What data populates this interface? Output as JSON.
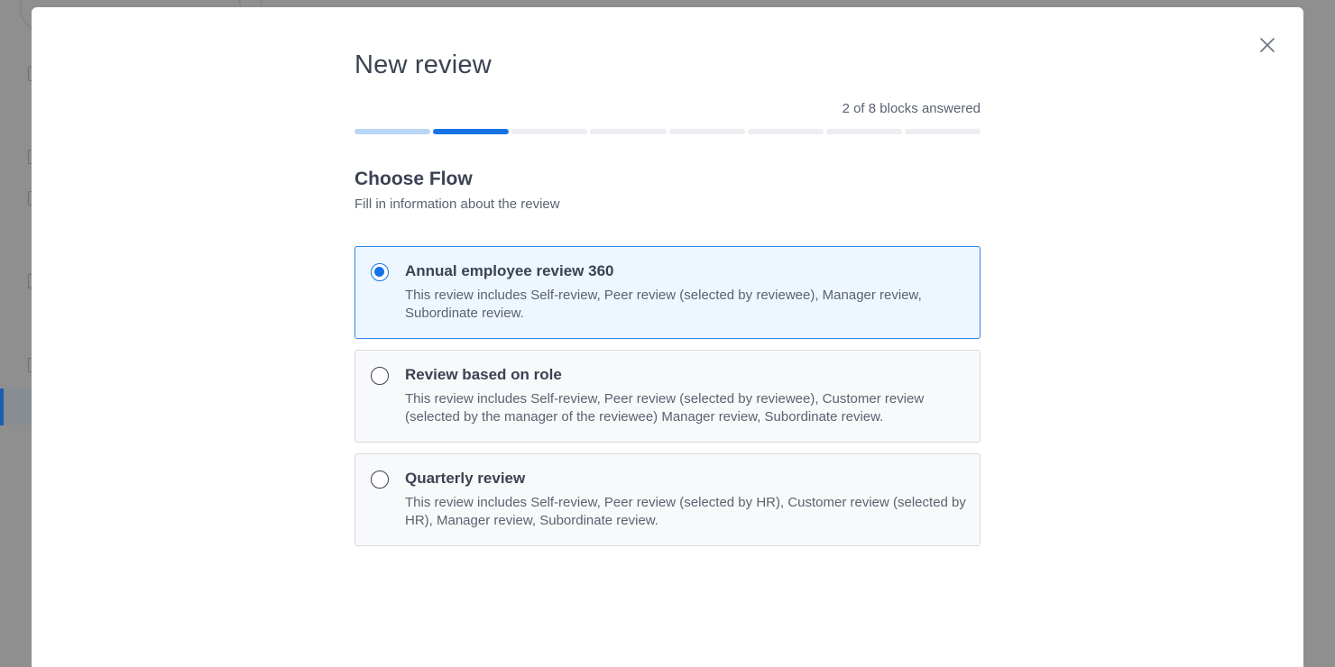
{
  "modal": {
    "title": "New review",
    "progress_text": "2 of 8 blocks answered",
    "progress": {
      "answered": 2,
      "total": 8,
      "current": 2
    },
    "section_title": "Choose Flow",
    "section_subtitle": "Fill in information about the review",
    "selected_index": 0,
    "options": [
      {
        "title": "Annual employee review 360",
        "description": "This review includes Self-review, Peer review (selected by reviewee), Manager review, Subordinate review."
      },
      {
        "title": "Review based on role",
        "description": "This review includes Self-review, Peer review (selected by reviewee), Customer review (selected by the manager of the reviewee) Manager review, Subordinate review."
      },
      {
        "title": "Quarterly review",
        "description": "This review includes Self-review, Peer review (selected by HR), Customer review (selected by HR), Manager review, Subordinate review."
      }
    ]
  },
  "colors": {
    "accent": "#1673e6",
    "progress_done": "#b8d6f6",
    "progress_empty": "#eceef1",
    "overlay": "#8f8f8f"
  },
  "icons": {
    "close": "close-icon"
  }
}
